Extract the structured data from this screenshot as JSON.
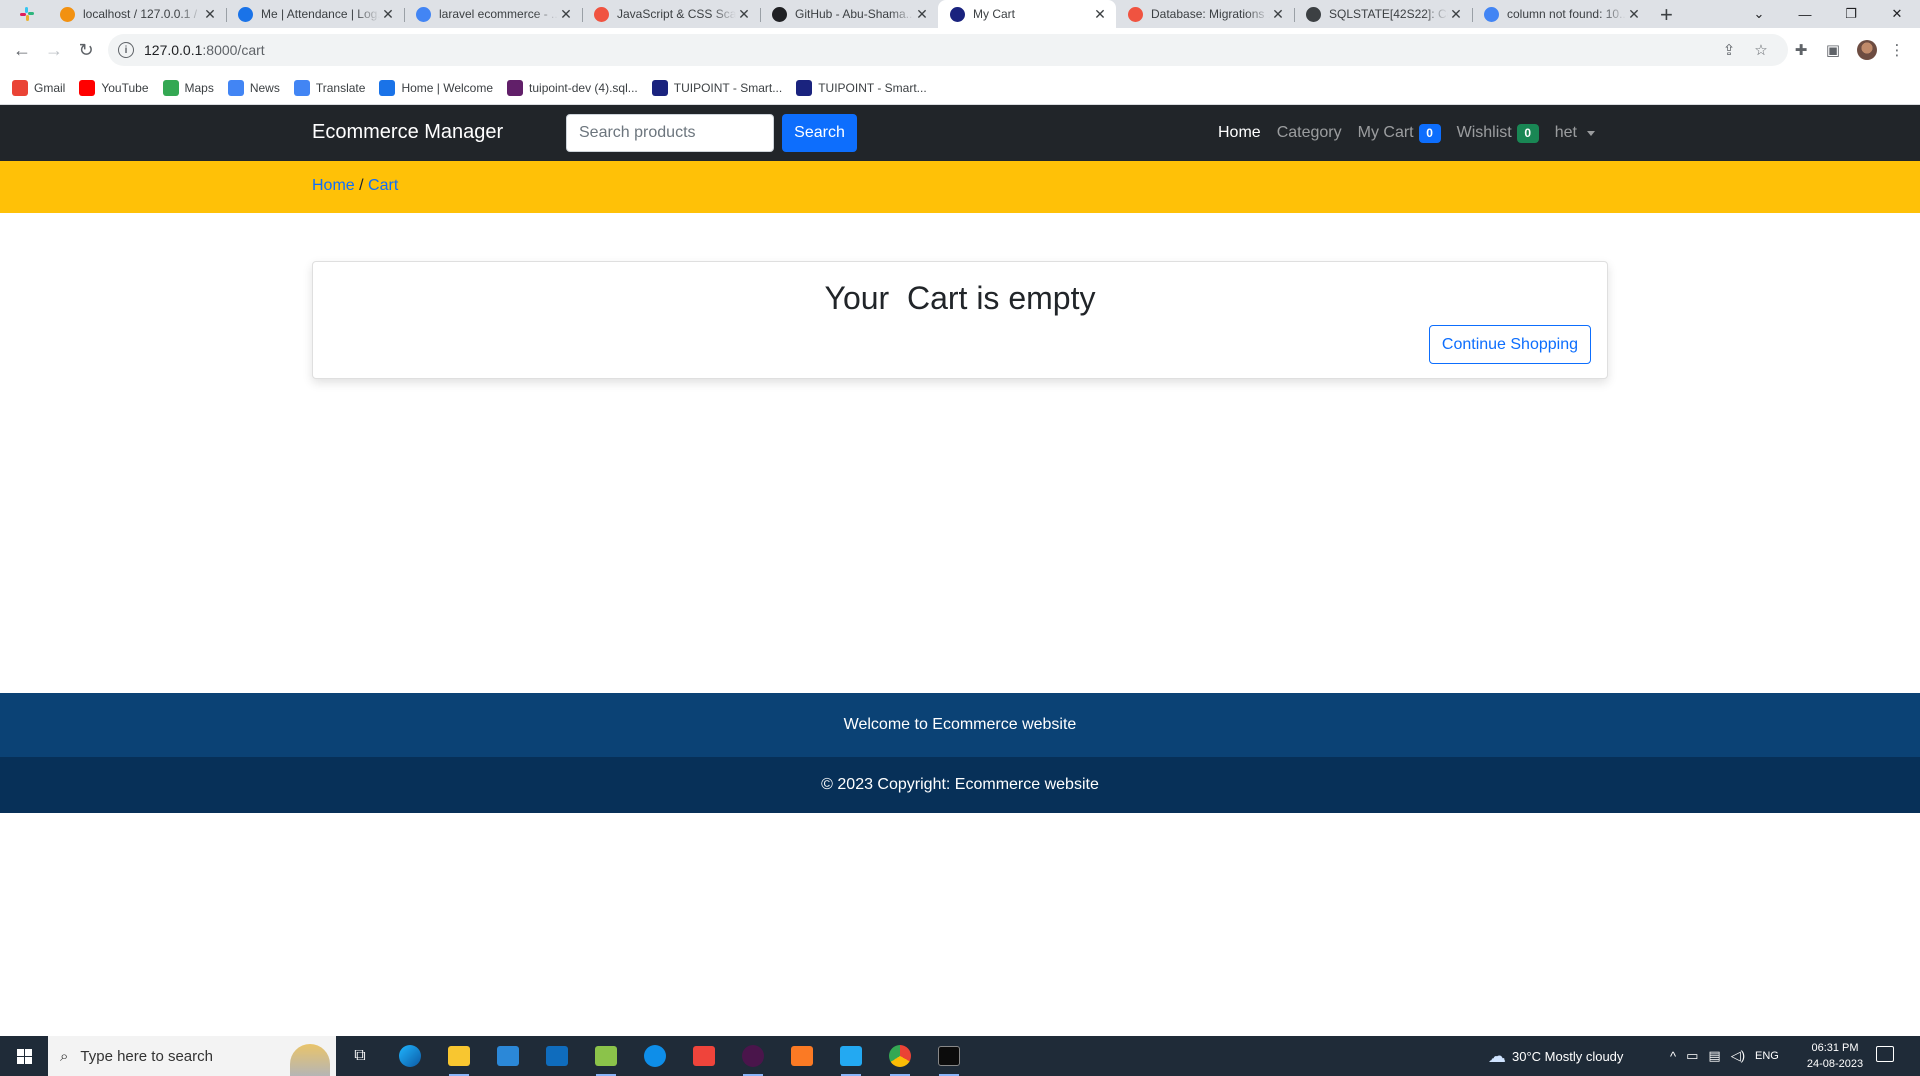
{
  "browser": {
    "tabs": [
      {
        "title": "localhost / 127.0.0.1 / ...",
        "favicon": "phpmyadmin-icon",
        "color": "#f29111"
      },
      {
        "title": "Me | Attendance | Log...",
        "favicon": "k-icon",
        "color": "#1a73e8"
      },
      {
        "title": "laravel ecommerce - ...",
        "favicon": "google-icon",
        "color": "#4285f4"
      },
      {
        "title": "JavaScript & CSS Sca...",
        "favicon": "laravel-icon",
        "color": "#f05340"
      },
      {
        "title": "GitHub - Abu-Shama...",
        "favicon": "github-icon",
        "color": "#202124"
      },
      {
        "title": "My Cart",
        "favicon": "tuipoint-icon",
        "color": "#1a237e"
      },
      {
        "title": "Database: Migrations ...",
        "favicon": "laravel-icon",
        "color": "#f05340"
      },
      {
        "title": "SQLSTATE[42S22]: Co...",
        "favicon": "send-icon",
        "color": "#3c4043"
      },
      {
        "title": "column not found: 10...",
        "favicon": "google-icon",
        "color": "#4285f4"
      }
    ],
    "active_tab_index": 5,
    "url_host": "127.0.0.1",
    "url_path": ":8000/cart",
    "bookmarks": [
      {
        "label": "Gmail",
        "icon": "gmail-icon",
        "color": "#ea4335"
      },
      {
        "label": "YouTube",
        "icon": "youtube-icon",
        "color": "#ff0000"
      },
      {
        "label": "Maps",
        "icon": "maps-icon",
        "color": "#34a853"
      },
      {
        "label": "News",
        "icon": "news-icon",
        "color": "#4285f4"
      },
      {
        "label": "Translate",
        "icon": "translate-icon",
        "color": "#4285f4"
      },
      {
        "label": "Home | Welcome",
        "icon": "k-icon",
        "color": "#1a73e8"
      },
      {
        "label": "tuipoint-dev (4).sql...",
        "icon": "slack-icon",
        "color": "#611f69"
      },
      {
        "label": "TUIPOINT - Smart...",
        "icon": "tuipoint-icon",
        "color": "#1a237e"
      },
      {
        "label": "TUIPOINT - Smart...",
        "icon": "tuipoint-icon",
        "color": "#1a237e"
      }
    ]
  },
  "site": {
    "brand": "Ecommerce Manager",
    "search": {
      "placeholder": "Search products",
      "button": "Search"
    },
    "nav": {
      "home": "Home",
      "category": "Category",
      "cart": "My Cart",
      "cart_count": "0",
      "wishlist": "Wishlist",
      "wishlist_count": "0",
      "user": "het"
    },
    "breadcrumb": {
      "home": "Home",
      "separator": " / ",
      "current": "Cart"
    },
    "cart": {
      "empty_message": "Your  Cart is empty",
      "continue_button": "Continue Shopping"
    },
    "footer": {
      "welcome": "Welcome to Ecommerce website",
      "copyright": "© 2023 Copyright: Ecommerce website"
    },
    "colors": {
      "navbar": "#212529",
      "breadcrumb_bar": "#ffc107",
      "primary": "#0d6efd",
      "success": "#198754",
      "footer_top": "#0b4275",
      "footer_bottom": "#073058"
    }
  },
  "taskbar": {
    "search_placeholder": "Type here to search",
    "weather": "30°C  Mostly cloudy",
    "language": "ENG",
    "time": "06:31 PM",
    "date": "24-08-2023"
  }
}
